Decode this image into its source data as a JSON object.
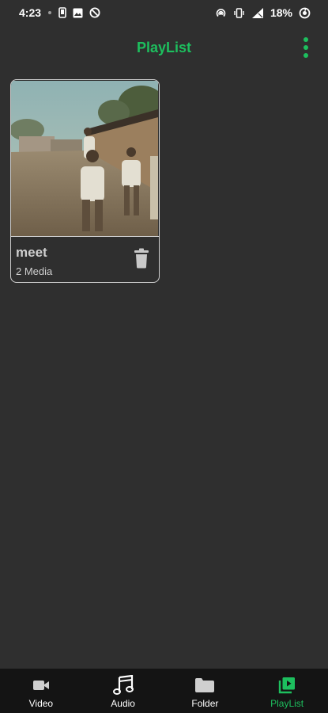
{
  "status_bar": {
    "time": "4:23",
    "battery_percent": "18%",
    "icons": [
      "phone-icon",
      "image-icon",
      "blocked-icon",
      "hotspot-icon",
      "vibrate-icon",
      "signal-icon",
      "battery-icon"
    ]
  },
  "app_bar": {
    "title": "PlayList",
    "menu_icon": "more-vert-icon"
  },
  "playlists": [
    {
      "name": "meet",
      "count": "2 Media",
      "delete_icon": "trash-icon"
    }
  ],
  "bottom_nav": {
    "items": [
      {
        "label": "Video",
        "icon": "video-camera-icon",
        "active": false
      },
      {
        "label": "Audio",
        "icon": "music-note-icon",
        "active": false
      },
      {
        "label": "Folder",
        "icon": "folder-icon",
        "active": false
      },
      {
        "label": "PlayList",
        "icon": "playlist-icon",
        "active": true
      }
    ]
  },
  "colors": {
    "accent": "#1dbf5e",
    "background": "#2f2f2f",
    "nav_background": "#141414"
  }
}
